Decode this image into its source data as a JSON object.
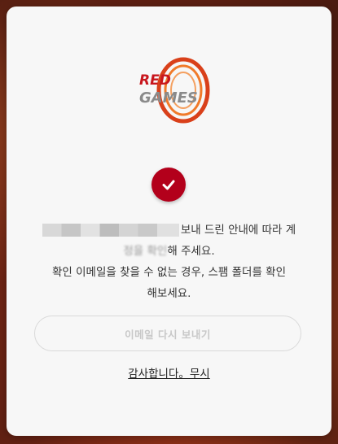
{
  "logo": {
    "line1": "RED",
    "line2": "GAMES"
  },
  "message": {
    "line1_visible": "보내 드린 안내에 따라 계",
    "line2_blurred_prefix": "정을 확인",
    "line2_rest": "해 주세요.",
    "line3": "확인 이메일을 찾을 수 없는 경우, 스팸 폴더를 확인",
    "line4": "해보세요."
  },
  "resend_button": {
    "label": "이메일 다시 보내기"
  },
  "dismiss_link": {
    "label": "감사합니다。무시"
  },
  "colors": {
    "accent": "#b3001b",
    "modal_bg": "#f7f7f7"
  }
}
